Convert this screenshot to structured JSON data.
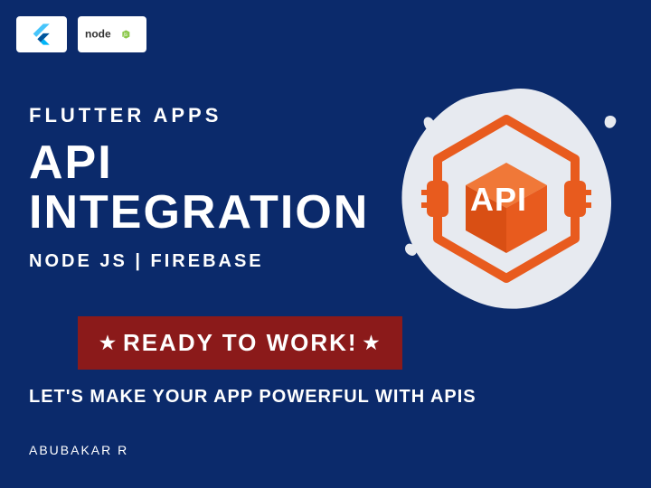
{
  "logos": {
    "flutter": "flutter",
    "node": "node"
  },
  "text": {
    "subtitle": "FLUTTER APPS",
    "title_line1": "API",
    "title_line2": "INTEGRATION",
    "subtitle2": "NODE JS | FIREBASE"
  },
  "badge": {
    "text": "READY TO WORK!"
  },
  "tagline": "LET'S MAKE YOUR APP POWERFUL WITH APIS",
  "author": "ABUBAKAR R",
  "api_graphic": {
    "label": "API"
  },
  "colors": {
    "background": "#0b2a6b",
    "accent_orange": "#e85b1e",
    "badge_red": "#8b1a1a"
  }
}
